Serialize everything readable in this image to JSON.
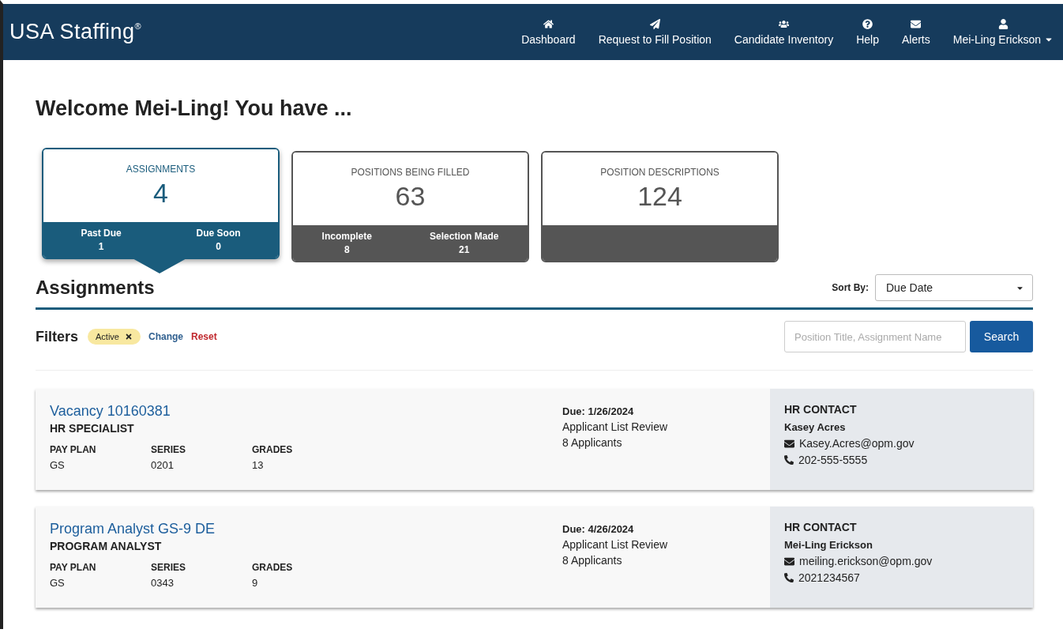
{
  "header": {
    "logo": "USA Staffing",
    "logo_mark": "®",
    "nav": [
      {
        "label": "Dashboard"
      },
      {
        "label": "Request to Fill Position"
      },
      {
        "label": "Candidate Inventory"
      },
      {
        "label": "Help"
      },
      {
        "label": "Alerts"
      },
      {
        "label": "Mei-Ling Erickson",
        "kind": "menu"
      }
    ]
  },
  "welcome": "Welcome Mei-Ling! You have ...",
  "tiles": [
    {
      "title": "ASSIGNMENTS",
      "count": "4",
      "selected": true,
      "stats": [
        {
          "label": "Past Due",
          "value": "1"
        },
        {
          "label": "Due Soon",
          "value": "0"
        }
      ]
    },
    {
      "title": "POSITIONS BEING FILLED",
      "count": "63",
      "selected": false,
      "stats": [
        {
          "label": "Incomplete",
          "value": "8"
        },
        {
          "label": "Selection Made",
          "value": "21"
        }
      ]
    },
    {
      "title": "POSITION DESCRIPTIONS",
      "count": "124",
      "selected": false
    }
  ],
  "section": {
    "title": "Assignments",
    "sort_label": "Sort By:",
    "sort_value": "Due Date"
  },
  "filters": {
    "label": "Filters",
    "chips": [
      {
        "label": "Active"
      }
    ],
    "actions": [
      {
        "label": "Change",
        "kind": "change"
      },
      {
        "label": "Reset",
        "kind": "reset"
      }
    ],
    "search_placeholder": "Position Title, Assignment Name",
    "search_button": "Search"
  },
  "assignments": [
    {
      "title": "Vacancy 10160381",
      "position": "HR SPECIALIST",
      "fields": [
        {
          "label": "PAY PLAN",
          "value": "GS"
        },
        {
          "label": "SERIES",
          "value": "0201"
        },
        {
          "label": "GRADES",
          "value": "13"
        }
      ],
      "due": "Due: 1/26/2024",
      "stage": "Applicant List Review",
      "applicants": "8 Applicants",
      "contact_heading": "HR CONTACT",
      "contact_name": "Kasey Acres",
      "email": "Kasey.Acres@opm.gov",
      "phone": "202-555-5555"
    },
    {
      "title": "Program Analyst GS-9 DE",
      "position": "PROGRAM ANALYST",
      "fields": [
        {
          "label": "PAY PLAN",
          "value": "GS"
        },
        {
          "label": "SERIES",
          "value": "0343"
        },
        {
          "label": "GRADES",
          "value": "9"
        }
      ],
      "due": "Due: 4/26/2024",
      "stage": "Applicant List Review",
      "applicants": "8 Applicants",
      "contact_heading": "HR CONTACT",
      "contact_name": "Mei-Ling Erickson",
      "email": "meiling.erickson@opm.gov",
      "phone": "2021234567"
    }
  ]
}
